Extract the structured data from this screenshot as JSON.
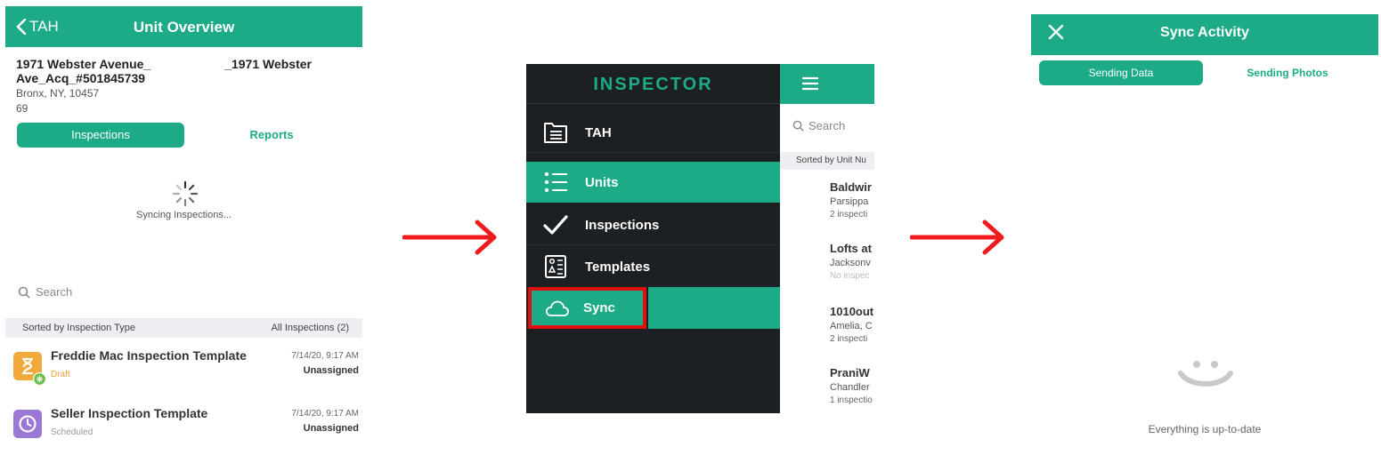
{
  "unit_overview": {
    "header": {
      "back_label": "TAH",
      "title": "Unit Overview"
    },
    "address": {
      "name_left": "1971 Webster Avenue_",
      "name_right": "_1971 Webster",
      "name_line2": "Ave_Acq_#501845739",
      "city": "Bronx, NY, 10457",
      "number": "69"
    },
    "tabs": {
      "active": "Inspections",
      "inactive": "Reports"
    },
    "sync_status": "Syncing Inspections...",
    "search_placeholder": "Search",
    "sort": {
      "left": "Sorted by Inspection Type",
      "right": "All Inspections (2)"
    },
    "rows": [
      {
        "name": "Freddie Mac Inspection Template",
        "status": "Draft",
        "date": "7/14/20, 9:17 AM",
        "assignee": "Unassigned",
        "icon": "hourglass-icon",
        "color": "#f2a93b",
        "status_color": "#e8a23a"
      },
      {
        "name": "Seller Inspection Template",
        "status": "Scheduled",
        "date": "7/14/20, 9:17 AM",
        "assignee": "Unassigned",
        "icon": "clock-icon",
        "color": "#9b78d6",
        "status_color": "#999999"
      }
    ]
  },
  "inspector_menu": {
    "brand": "INSPECTOR",
    "items": [
      {
        "label": "TAH",
        "icon": "folder-list-icon",
        "active": false
      },
      {
        "label": "Units",
        "icon": "list-icon",
        "active": true
      },
      {
        "label": "Inspections",
        "icon": "checkmark-icon",
        "active": false
      },
      {
        "label": "Templates",
        "icon": "template-icon",
        "active": false
      },
      {
        "label": "Sync",
        "icon": "cloud-icon",
        "active": true,
        "highlighted": true
      }
    ],
    "right_pane": {
      "search_placeholder": "Search",
      "sort_label": "Sorted by Unit Nu",
      "units": [
        {
          "name": "Baldwir",
          "city": "Parsippa",
          "sub": "2 inspecti"
        },
        {
          "name": "Lofts at",
          "city": "Jacksonv",
          "sub": "No inspec"
        },
        {
          "name": "1010out",
          "city": "Amelia, C",
          "sub": "2 inspecti"
        },
        {
          "name": "PraniW",
          "city": "Chandler",
          "sub": "1 inspectio"
        }
      ]
    }
  },
  "sync_activity": {
    "header": {
      "title": "Sync Activity"
    },
    "tabs": {
      "active": "Sending Data",
      "inactive": "Sending Photos"
    },
    "empty_message": "Everything is up-to-date"
  },
  "colors": {
    "accent": "#1cab86",
    "menu_bg": "#1c2023",
    "highlight": "#e11010",
    "arrow": "#ee1c1c"
  }
}
